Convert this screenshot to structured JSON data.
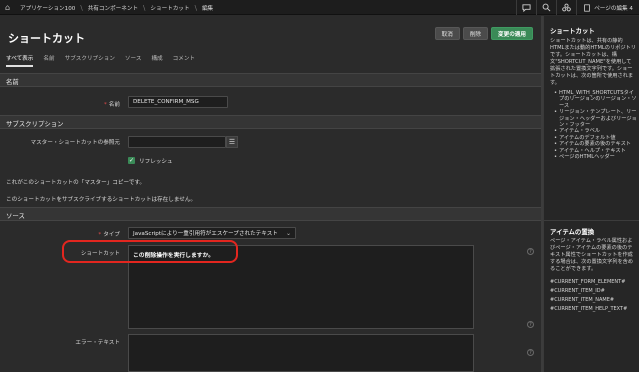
{
  "topbar": {
    "breadcrumbs": [
      "アプリケーション100",
      "共有コンポーネント",
      "ショートカット",
      "編集"
    ],
    "page_label": "ページの編集 4"
  },
  "header": {
    "title": "ショートカット",
    "cancel_label": "取消",
    "delete_label": "削除",
    "apply_label": "変更の適用"
  },
  "tabs": [
    "すべて表示",
    "名前",
    "サブスクリプション",
    "ソース",
    "構成",
    "コメント"
  ],
  "sections": {
    "name": {
      "title": "名前",
      "name_label": "名前",
      "name_value": "DELETE_CONFIRM_MSG"
    },
    "subscription": {
      "title": "サブスクリプション",
      "master_label": "マスター・ショートカットの参照元",
      "master_value": "",
      "refresh_label": "リフレッシュ",
      "note1": "これがこのショートカットの「マスター」コピーです。",
      "note2": "このショートカットをサブスクライブするショートカットは存在しません。"
    },
    "source": {
      "title": "ソース",
      "type_label": "タイプ",
      "type_value": "JavaScriptにより一重引用符がエスケープされたテキスト",
      "shortcut_label": "ショートカット",
      "shortcut_value": "この削除操作を実行しますか。",
      "error_label": "エラー・テキスト"
    }
  },
  "sidebar": {
    "shortcut_title": "ショートカット",
    "shortcut_text": "ショートカットは、共有の静的HTMLまたは動的HTMLのリポジトリです。ショートカットは、構文\"SHORTCUT_NAME\"を使用して拡張された置換文字列です。ショートカットは、次の箇所で使用されます。",
    "usage_items": [
      "HTML_WITH_SHORTCUTSタイプのリージョンのリージョン・ソース",
      "リージョン・テンプレート、リージョン・ヘッダーおよびリージョン・フッター",
      "アイテム・ラベル",
      "アイテムのデフォルト値",
      "アイテムの要素の後のテキスト",
      "アイテム・ヘルプ・テキスト",
      "ページのHTMLヘッダー"
    ],
    "item_title": "アイテムの置換",
    "item_text": "ページ・アイテム・ラベル属性およびページ・アイテムの要素の後のテキスト属性でショートカットを作成する場合は、次の置換文字列を含めることができます。",
    "substitutions": [
      "#CURRENT_FORM_ELEMENT#",
      "#CURRENT_ITEM_ID#",
      "#CURRENT_ITEM_NAME#",
      "#CURRENT_ITEM_HELP_TEXT#"
    ]
  }
}
